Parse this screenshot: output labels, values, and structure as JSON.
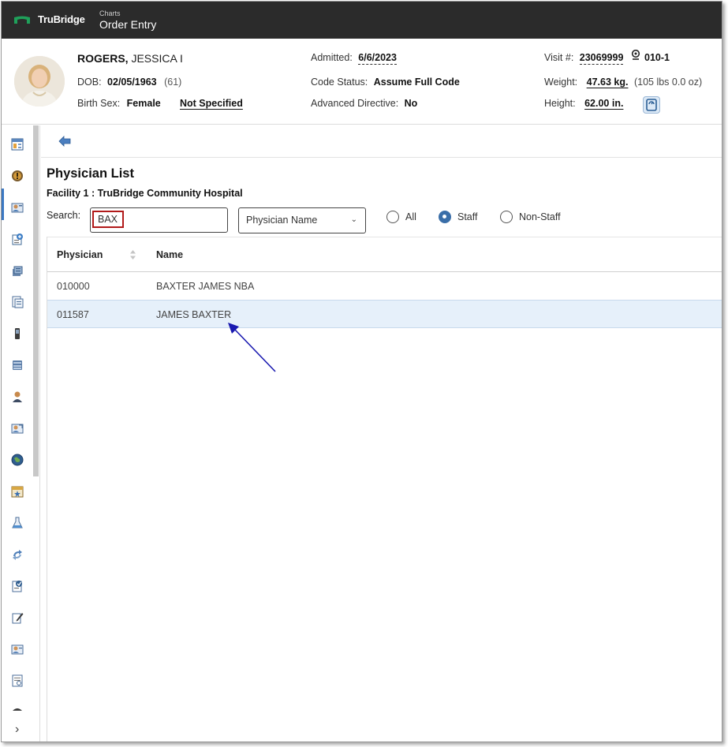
{
  "app": {
    "logo_text": "TruBridge",
    "breadcrumb_small": "Charts",
    "breadcrumb_title": "Order Entry"
  },
  "patient": {
    "last_name": "ROGERS,",
    "first_name": "JESSICA I",
    "dob_label": "DOB:",
    "dob_value": "02/05/1963",
    "age": "(61)",
    "birth_sex_label": "Birth Sex:",
    "birth_sex_value": "Female",
    "gender_identity": "Not Specified",
    "admitted_label": "Admitted:",
    "admitted_value": "6/6/2023",
    "code_status_label": "Code Status:",
    "code_status_value": "Assume Full Code",
    "advanced_directive_label": "Advanced Directive:",
    "advanced_directive_value": "No",
    "visit_label": "Visit #:",
    "visit_value": "23069999",
    "room": "010-1",
    "weight_label": "Weight:",
    "weight_value": "47.63 kg.",
    "weight_lbs": "(105 lbs 0.0 oz)",
    "height_label": "Height:",
    "height_value": "62.00 in."
  },
  "main": {
    "title": "Physician List",
    "facility": "Facility 1 : TruBridge Community Hospital",
    "search_label": "Search:",
    "search_value": "BAX",
    "search_by": "Physician Name",
    "radios": [
      {
        "label": "All",
        "selected": false
      },
      {
        "label": "Staff",
        "selected": true
      },
      {
        "label": "Non-Staff",
        "selected": false
      }
    ],
    "table": {
      "columns": [
        "Physician",
        "Name"
      ],
      "rows": [
        {
          "physician": "010000",
          "name": "BAXTER JAMES NBA",
          "selected": false
        },
        {
          "physician": "011587",
          "name": "JAMES BAXTER",
          "selected": true
        }
      ]
    }
  },
  "colors": {
    "topbar": "#2b2b2b",
    "logo_green": "#1fa05a",
    "accent_blue": "#3a6ea8",
    "selected_row": "#e6f0fa",
    "search_highlight": "#b11a1a",
    "annotation_arrow": "#1a1ab0"
  },
  "rail_icons": [
    "chart-summary-icon",
    "alerts-icon",
    "order-entry-icon",
    "orders-icon",
    "medications-icon",
    "documents-icon",
    "device-icon",
    "database-icon",
    "person-icon",
    "consult-icon",
    "globe-icon",
    "calendar-icon",
    "lab-flask-icon",
    "refresh-icon",
    "assessment-icon",
    "edit-icon",
    "physician-icon",
    "notes-icon",
    "more-icon"
  ]
}
